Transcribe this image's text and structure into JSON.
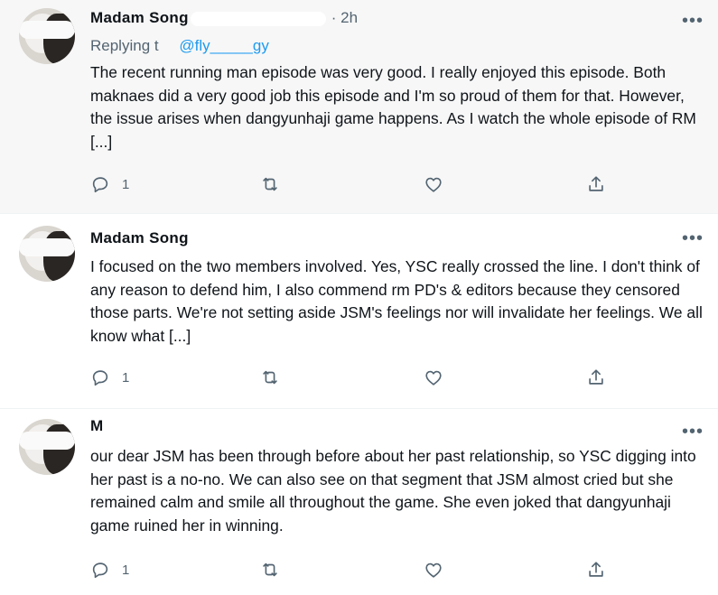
{
  "tweets": [
    {
      "name": "Madam Song",
      "time": "· 2h",
      "replying_prefix": "Replying t",
      "replying_handle": "@fly_____gy",
      "text": "The recent running man episode was very good. I really enjoyed this episode. Both maknaes did a very good job this episode and I'm so proud of them for that. However, the issue arises when dangyunhaji game happens. As I watch the whole episode of RM [...]",
      "reply_count": "1",
      "more": "•••"
    },
    {
      "name": "Madam Song",
      "text": "I focused on the two members involved. Yes, YSC really crossed the line. I don't think of any reason to defend him, I also commend rm PD's & editors because they censored those parts. We're not setting aside JSM's feelings nor will invalidate her feelings. We all know what [...]",
      "reply_count": "1",
      "more": "•••"
    },
    {
      "name": "M",
      "text": "our dear JSM has been through before about her past relationship, so YSC digging into her past is a no-no. We can also see on that segment that JSM almost cried but she remained calm and smile all throughout the game. She even joked that dangyunhaji game ruined her in winning.",
      "reply_count": "1",
      "more": "•••"
    }
  ],
  "icons": {
    "reply": "reply-icon",
    "retweet": "retweet-icon",
    "like": "heart-icon",
    "share": "share-icon",
    "more": "more-icon"
  },
  "colors": {
    "text": "#0f1419",
    "secondary": "#536471",
    "link": "#1d9bf0",
    "highlight_bg": "#f7f7f7"
  }
}
